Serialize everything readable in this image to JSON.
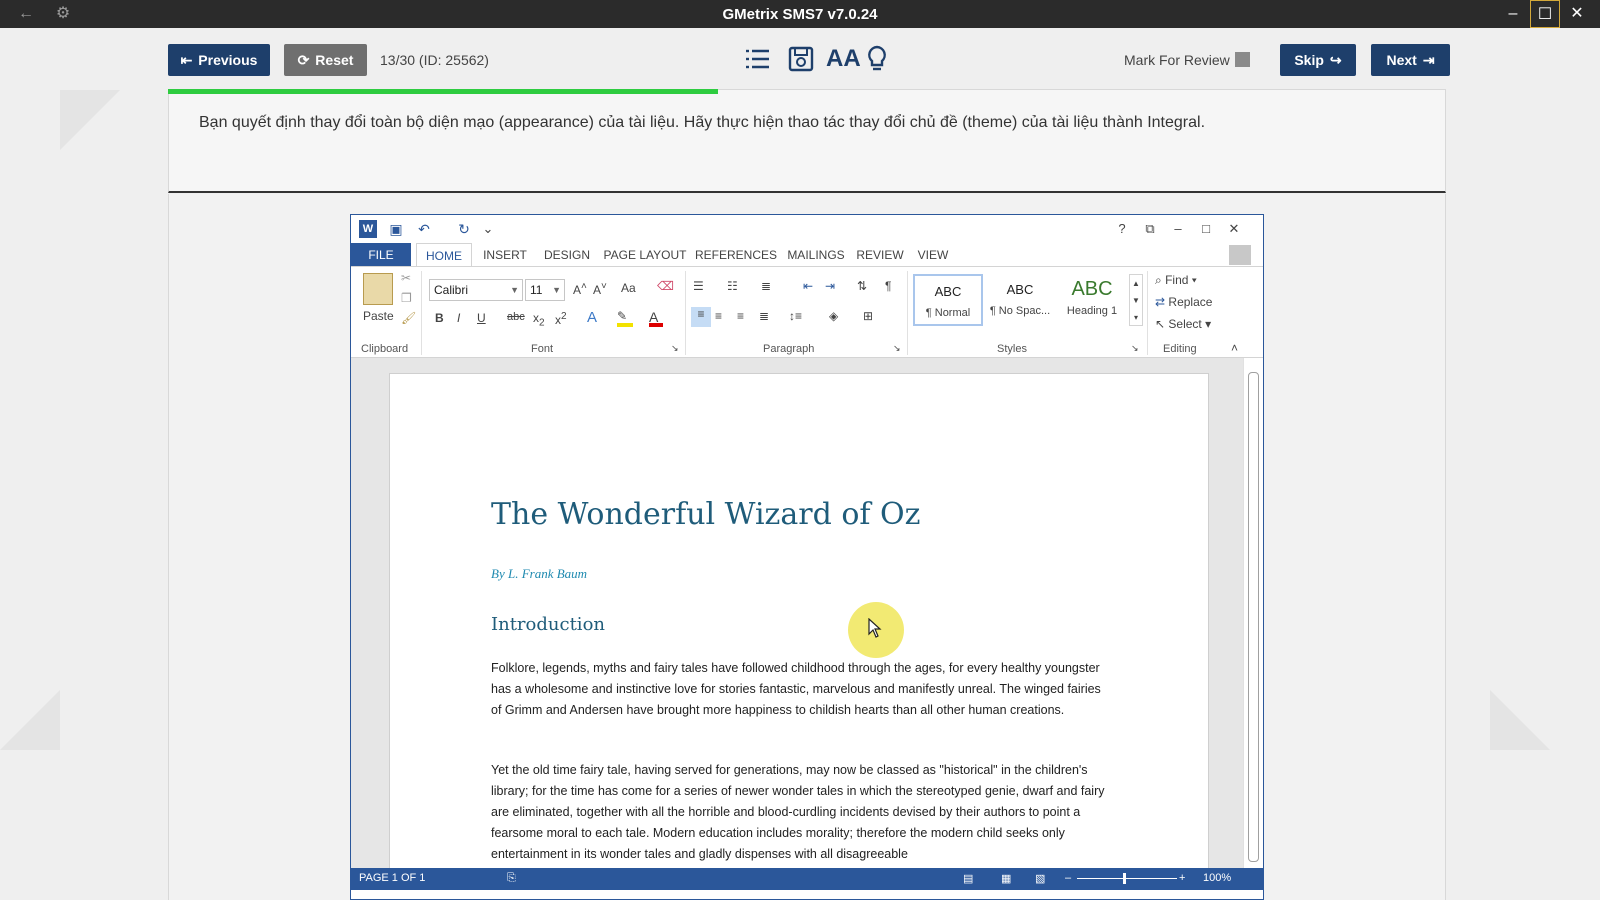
{
  "app": {
    "title": "GMetrix SMS7 v7.0.24"
  },
  "toolbar": {
    "previous_label": "Previous",
    "reset_label": "Reset",
    "question_counter": "13/30 (ID: 25562)",
    "mark_for_review_label": "Mark For Review",
    "skip_label": "Skip",
    "next_label": "Next",
    "progress_fraction": 0.43
  },
  "question": {
    "text": "Bạn quyết định thay đổi toàn bộ diện mạo (appearance) của tài liệu. Hãy thực hiện thao tác thay đổi chủ đề (theme) của tài liệu thành Integral."
  },
  "word": {
    "tabs": [
      "FILE",
      "HOME",
      "INSERT",
      "DESIGN",
      "PAGE LAYOUT",
      "REFERENCES",
      "MAILINGS",
      "REVIEW",
      "VIEW"
    ],
    "clipboard": {
      "paste_label": "Paste",
      "group_label": "Clipboard"
    },
    "font": {
      "name": "Calibri",
      "size": "11",
      "group_label": "Font",
      "aa_label": "Aa"
    },
    "paragraph": {
      "group_label": "Paragraph"
    },
    "styles": {
      "group_label": "Styles",
      "items": [
        {
          "sample": "ABC",
          "name": "¶ Normal"
        },
        {
          "sample": "ABC",
          "name": "¶ No Spac..."
        },
        {
          "sample": "ABC",
          "name": "Heading 1"
        }
      ]
    },
    "editing": {
      "group_label": "Editing",
      "find_label": "Find",
      "replace_label": "Replace",
      "select_label": "Select"
    },
    "document": {
      "title": "The Wonderful Wizard of Oz",
      "author": "By L. Frank Baum",
      "heading": "Introduction",
      "para1": "Folklore, legends, myths and fairy tales have followed childhood through the ages, for every healthy youngster has a wholesome and instinctive love for stories fantastic, marvelous and manifestly unreal. The winged fairies of Grimm and Andersen have brought more happiness to childish hearts than all other human creations.",
      "para2": "Yet the old time fairy tale, having served for generations, may now be classed as \"historical\" in the children's library; for the time has come for a series of newer wonder tales in which the stereotyped genie, dwarf and fairy are eliminated, together with all the horrible and blood-curdling incidents devised by their authors to point a fearsome moral to each tale. Modern education includes morality; therefore the modern child seeks only entertainment in its wonder tales and gladly dispenses with all disagreeable"
    },
    "status": {
      "page_label": "PAGE 1 OF 1",
      "zoom": "100%"
    }
  },
  "colors": {
    "nav_button": "#1e3f6b",
    "progress": "#2ecc40",
    "word_blue": "#2b579a"
  }
}
